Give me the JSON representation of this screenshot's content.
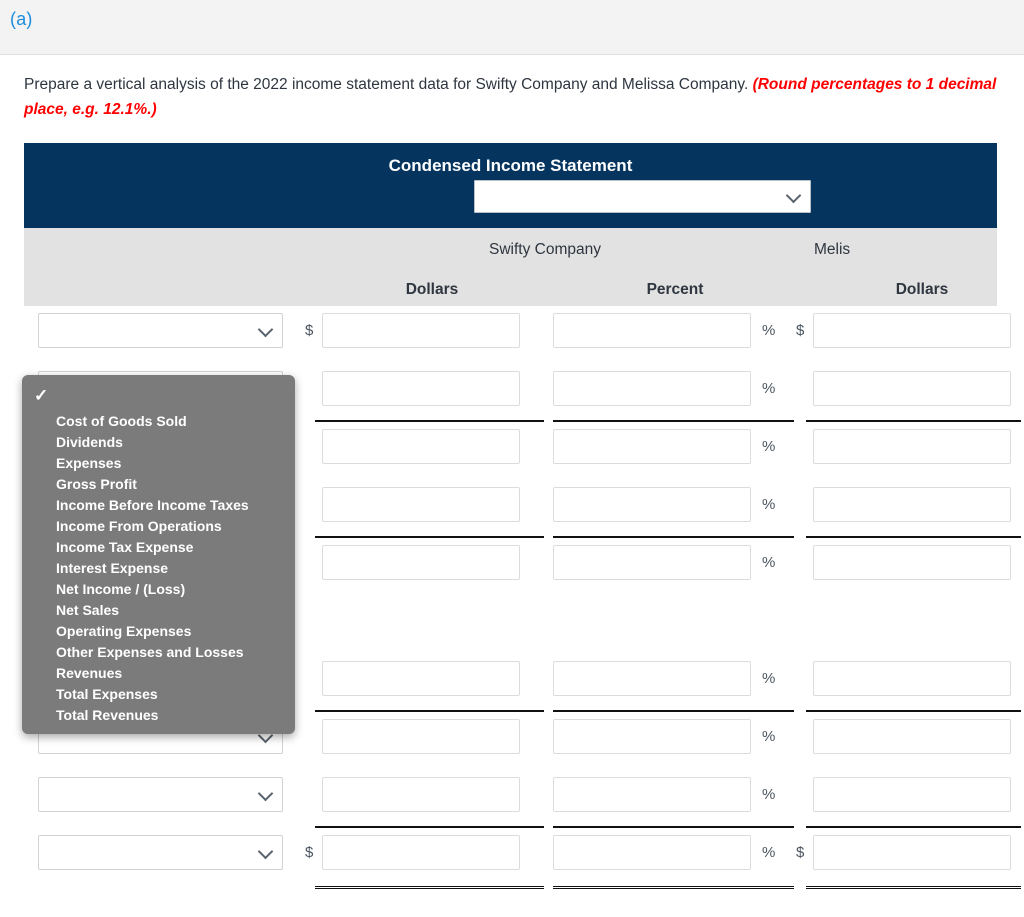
{
  "part": {
    "label": "(a)"
  },
  "instructions": {
    "text": "Prepare a vertical analysis of the 2022 income statement data for Swifty Company and Melissa Company. ",
    "hint": "(Round percentages to 1 decimal place, e.g. 12.1%.)"
  },
  "statement": {
    "title": "Condensed Income Statement",
    "period_select": {
      "value": "",
      "icon": "chevron-down-icon"
    },
    "companies": [
      {
        "name": "Swifty Company"
      },
      {
        "name": "Melis"
      }
    ],
    "column_headers": {
      "dollars_1": "Dollars",
      "percent_1": "Percent",
      "dollars_2": "Dollars"
    },
    "symbols": {
      "dollar": "$",
      "percent": "%"
    },
    "rows": [
      {
        "account": "",
        "dollars_1": "",
        "percent_1": "",
        "dollars_2": "",
        "show_dollar_sign": true,
        "show_percent_sign": true,
        "show_dollar_sign_2": true,
        "rule": "none",
        "spacer": false
      },
      {
        "account": "",
        "dollars_1": "",
        "percent_1": "",
        "dollars_2": "",
        "show_dollar_sign": false,
        "show_percent_sign": true,
        "show_dollar_sign_2": false,
        "rule": "single",
        "spacer": false
      },
      {
        "account": "",
        "dollars_1": "",
        "percent_1": "",
        "dollars_2": "",
        "show_dollar_sign": false,
        "show_percent_sign": true,
        "show_dollar_sign_2": false,
        "rule": "none",
        "spacer": false
      },
      {
        "account": "",
        "dollars_1": "",
        "percent_1": "",
        "dollars_2": "",
        "show_dollar_sign": false,
        "show_percent_sign": true,
        "show_dollar_sign_2": false,
        "rule": "single",
        "spacer": false
      },
      {
        "account": "",
        "dollars_1": "",
        "percent_1": "",
        "dollars_2": "",
        "show_dollar_sign": false,
        "show_percent_sign": true,
        "show_dollar_sign_2": false,
        "rule": "none",
        "spacer": false
      },
      {
        "account": "",
        "dollars_1": "",
        "percent_1": "",
        "dollars_2": "",
        "show_dollar_sign": false,
        "show_percent_sign": false,
        "show_dollar_sign_2": false,
        "rule": "none",
        "spacer": true
      },
      {
        "account": "",
        "dollars_1": "",
        "percent_1": "",
        "dollars_2": "",
        "show_dollar_sign": false,
        "show_percent_sign": true,
        "show_dollar_sign_2": false,
        "rule": "single",
        "spacer": false
      },
      {
        "account": "",
        "dollars_1": "",
        "percent_1": "",
        "dollars_2": "",
        "show_dollar_sign": false,
        "show_percent_sign": true,
        "show_dollar_sign_2": false,
        "rule": "none",
        "spacer": false
      },
      {
        "account": "",
        "dollars_1": "",
        "percent_1": "",
        "dollars_2": "",
        "show_dollar_sign": false,
        "show_percent_sign": true,
        "show_dollar_sign_2": false,
        "rule": "single",
        "spacer": false
      },
      {
        "account": "",
        "dollars_1": "",
        "percent_1": "",
        "dollars_2": "",
        "show_dollar_sign": true,
        "show_percent_sign": true,
        "show_dollar_sign_2": true,
        "rule": "double",
        "spacer": false
      }
    ]
  },
  "dropdown": {
    "open": true,
    "selected_index": 0,
    "check_icon": "check-icon",
    "options": [
      "",
      "Cost of Goods Sold",
      "Dividends",
      "Expenses",
      "Gross Profit",
      "Income Before Income Taxes",
      "Income From Operations",
      "Income Tax Expense",
      "Interest Expense",
      "Net Income / (Loss)",
      "Net Sales",
      "Operating Expenses",
      "Other Expenses and Losses",
      "Revenues",
      "Total Expenses",
      "Total Revenues"
    ]
  },
  "colors": {
    "header_navy": "#05355f",
    "head_band_gray": "#e2e2e2",
    "part_blue": "#1b8cdc",
    "hint_red": "#ff0000",
    "dropdown_gray": "#7b7b7b"
  }
}
